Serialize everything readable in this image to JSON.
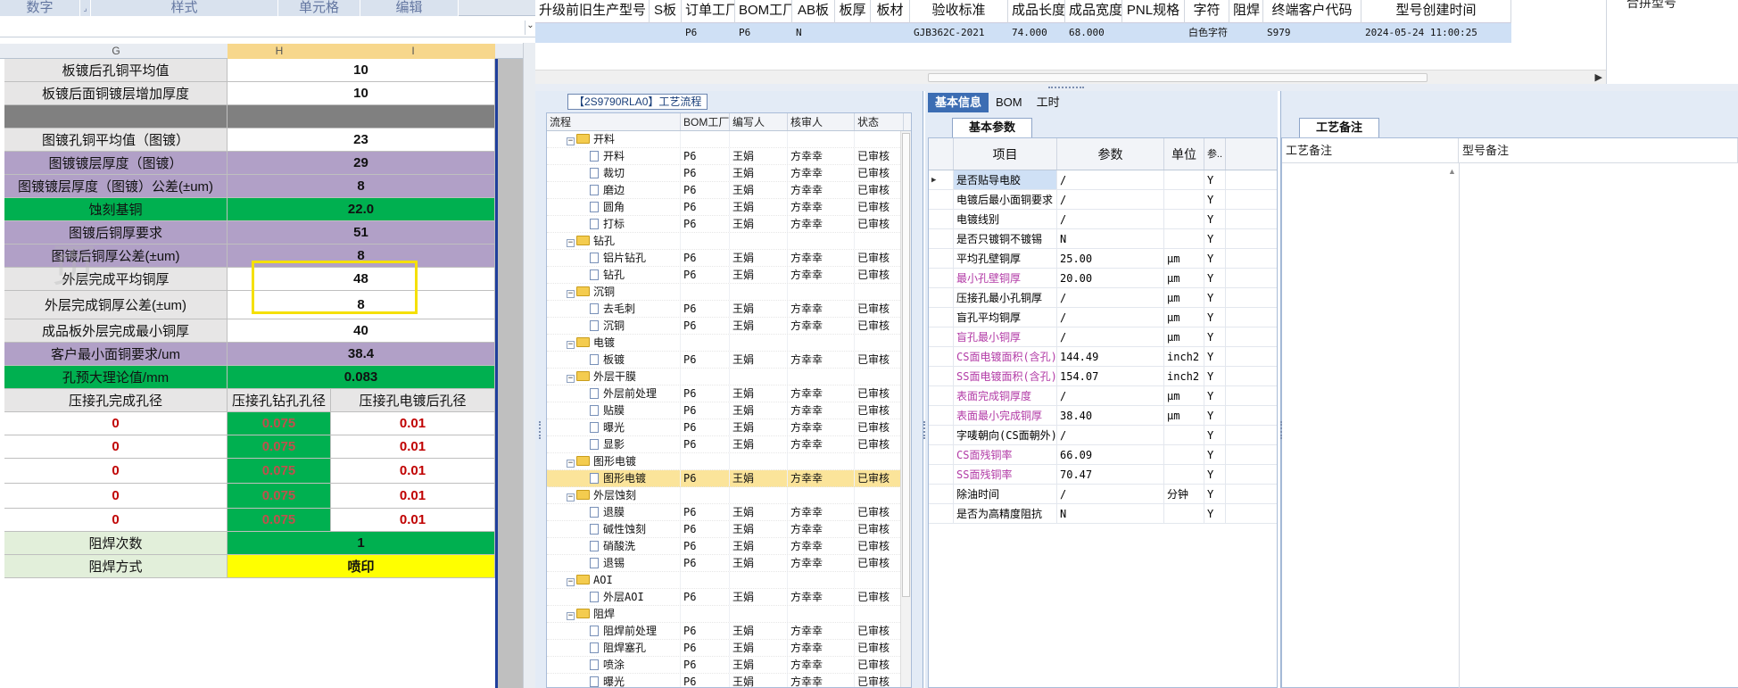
{
  "excel": {
    "ribbon_groups": [
      "数字",
      "样式",
      "单元格",
      "编辑"
    ],
    "columns": [
      "G",
      "H",
      "I"
    ],
    "rows": [
      {
        "label": "板镀后孔铜平均值",
        "value": "10",
        "label_bg": "lgray",
        "value_bg": "white"
      },
      {
        "label": "板镀后面铜镀层增加厚度",
        "value": "10",
        "label_bg": "lgray",
        "value_bg": "white"
      },
      {
        "label": "",
        "value": "",
        "label_bg": "gray",
        "value_bg": "gray"
      },
      {
        "label": "图镀孔铜平均值（图镀）",
        "value": "23",
        "label_bg": "lgray",
        "value_bg": "white"
      },
      {
        "label": "图镀镀层厚度（图镀）",
        "value": "29",
        "label_bg": "lavender",
        "value_bg": "lavender"
      },
      {
        "label": "图镀镀层厚度（图镀）公差(±um)",
        "value": "8",
        "label_bg": "lavender",
        "value_bg": "lavender"
      },
      {
        "label": "蚀刻基铜",
        "value": "22.0",
        "label_bg": "green",
        "value_bg": "green"
      },
      {
        "label": "图镀后铜厚要求",
        "value": "51",
        "label_bg": "lavender",
        "value_bg": "lavender"
      },
      {
        "label": "图镀后铜厚公差(±um)",
        "value": "8",
        "label_bg": "lavender",
        "value_bg": "lavender"
      },
      {
        "label": "外层完成平均铜厚",
        "value": "48",
        "label_bg": "lgray",
        "value_bg": "white"
      },
      {
        "label": "外层完成铜厚公差(±um)",
        "value": "8",
        "label_bg": "lgray",
        "value_bg": "white"
      },
      {
        "label": "成品板外层完成最小铜厚",
        "value": "40",
        "label_bg": "lgray",
        "value_bg": "white"
      },
      {
        "label": "客户最小面铜要求/um",
        "value": "38.4",
        "label_bg": "lavender",
        "value_bg": "lavender"
      },
      {
        "label": "孔预大理论值/mm",
        "value": "0.083",
        "label_bg": "green",
        "value_bg": "green"
      }
    ],
    "hole_header": [
      "压接孔完成孔径",
      "压接孔钻孔孔径",
      "压接孔电镀后孔径"
    ],
    "hole_rows": [
      [
        "0",
        "0.075",
        "0.01"
      ],
      [
        "0",
        "0.075",
        "0.01"
      ],
      [
        "0",
        "0.075",
        "0.01"
      ],
      [
        "0",
        "0.075",
        "0.01"
      ],
      [
        "0",
        "0.075",
        "0.01"
      ]
    ],
    "solder_count": {
      "label": "阻焊次数",
      "value": "1"
    },
    "solder_method": {
      "label": "阻焊方式",
      "value": "喷印"
    },
    "watermark": "页"
  },
  "top_table": {
    "headers": [
      "升级前旧生产型号",
      "S板",
      "订单工厂",
      "BOM工厂",
      "AB板",
      "板厚",
      "板材",
      "验收标准",
      "成品长度",
      "成品宽度",
      "PNL规格",
      "字符",
      "阻焊",
      "终端客户代码",
      "型号创建时间"
    ],
    "row": [
      "",
      "",
      "P6",
      "P6",
      "N",
      "",
      "",
      "GJB362C-2021",
      "74.000",
      "68.000",
      "",
      "白色字符",
      "",
      "S979",
      "2024-05-24 11:00:25"
    ],
    "right_panel_label": "合拼型号"
  },
  "process": {
    "title": "【2S9790RLA0】工艺流程",
    "columns": [
      "流程",
      "BOM工厂",
      "编写人",
      "核审人",
      "状态"
    ],
    "rows": [
      {
        "name": "开料",
        "type": "folder"
      },
      {
        "name": "开料",
        "type": "doc",
        "fac": "P6",
        "writer": "王娟",
        "checker": "方幸幸",
        "status": "已审核"
      },
      {
        "name": "裁切",
        "type": "doc",
        "fac": "P6",
        "writer": "王娟",
        "checker": "方幸幸",
        "status": "已审核"
      },
      {
        "name": "磨边",
        "type": "doc",
        "fac": "P6",
        "writer": "王娟",
        "checker": "方幸幸",
        "status": "已审核"
      },
      {
        "name": "圆角",
        "type": "doc",
        "fac": "P6",
        "writer": "王娟",
        "checker": "方幸幸",
        "status": "已审核"
      },
      {
        "name": "打标",
        "type": "doc",
        "fac": "P6",
        "writer": "王娟",
        "checker": "方幸幸",
        "status": "已审核"
      },
      {
        "name": "钻孔",
        "type": "folder"
      },
      {
        "name": "铝片钻孔",
        "type": "doc",
        "fac": "P6",
        "writer": "王娟",
        "checker": "方幸幸",
        "status": "已审核"
      },
      {
        "name": "钻孔",
        "type": "doc",
        "fac": "P6",
        "writer": "王娟",
        "checker": "方幸幸",
        "status": "已审核"
      },
      {
        "name": "沉铜",
        "type": "folder"
      },
      {
        "name": "去毛刺",
        "type": "doc",
        "fac": "P6",
        "writer": "王娟",
        "checker": "方幸幸",
        "status": "已审核"
      },
      {
        "name": "沉铜",
        "type": "doc",
        "fac": "P6",
        "writer": "王娟",
        "checker": "方幸幸",
        "status": "已审核"
      },
      {
        "name": "电镀",
        "type": "folder"
      },
      {
        "name": "板镀",
        "type": "doc",
        "fac": "P6",
        "writer": "王娟",
        "checker": "方幸幸",
        "status": "已审核"
      },
      {
        "name": "外层干膜",
        "type": "folder"
      },
      {
        "name": "外层前处理",
        "type": "doc",
        "fac": "P6",
        "writer": "王娟",
        "checker": "方幸幸",
        "status": "已审核"
      },
      {
        "name": "贴膜",
        "type": "doc",
        "fac": "P6",
        "writer": "王娟",
        "checker": "方幸幸",
        "status": "已审核"
      },
      {
        "name": "曝光",
        "type": "doc",
        "fac": "P6",
        "writer": "王娟",
        "checker": "方幸幸",
        "status": "已审核"
      },
      {
        "name": "显影",
        "type": "doc",
        "fac": "P6",
        "writer": "王娟",
        "checker": "方幸幸",
        "status": "已审核"
      },
      {
        "name": "图形电镀",
        "type": "folder"
      },
      {
        "name": "图形电镀",
        "type": "doc",
        "fac": "P6",
        "writer": "王娟",
        "checker": "方幸幸",
        "status": "已审核",
        "selected": true
      },
      {
        "name": "外层蚀刻",
        "type": "folder"
      },
      {
        "name": "退膜",
        "type": "doc",
        "fac": "P6",
        "writer": "王娟",
        "checker": "方幸幸",
        "status": "已审核"
      },
      {
        "name": "碱性蚀刻",
        "type": "doc",
        "fac": "P6",
        "writer": "王娟",
        "checker": "方幸幸",
        "status": "已审核"
      },
      {
        "name": "硝酸洗",
        "type": "doc",
        "fac": "P6",
        "writer": "王娟",
        "checker": "方幸幸",
        "status": "已审核"
      },
      {
        "name": "退锡",
        "type": "doc",
        "fac": "P6",
        "writer": "王娟",
        "checker": "方幸幸",
        "status": "已审核"
      },
      {
        "name": "AOI",
        "type": "folder"
      },
      {
        "name": "外层AOI",
        "type": "doc",
        "fac": "P6",
        "writer": "王娟",
        "checker": "方幸幸",
        "status": "已审核"
      },
      {
        "name": "阻焊",
        "type": "folder"
      },
      {
        "name": "阻焊前处理",
        "type": "doc",
        "fac": "P6",
        "writer": "王娟",
        "checker": "方幸幸",
        "status": "已审核"
      },
      {
        "name": "阻焊塞孔",
        "type": "doc",
        "fac": "P6",
        "writer": "王娟",
        "checker": "方幸幸",
        "status": "已审核"
      },
      {
        "name": "喷涂",
        "type": "doc",
        "fac": "P6",
        "writer": "王娟",
        "checker": "方幸幸",
        "status": "已审核"
      },
      {
        "name": "曝光",
        "type": "doc",
        "fac": "P6",
        "writer": "王娟",
        "checker": "方幸幸",
        "status": "已审核"
      }
    ]
  },
  "info": {
    "tabs": [
      "基本信息",
      "BOM",
      "工时"
    ],
    "sub_tab": "基本参数",
    "columns": [
      "项目",
      "参数",
      "单位",
      "参.."
    ],
    "rows": [
      {
        "item": "是否贴导电胶",
        "value": "/",
        "unit": "",
        "flag": "Y",
        "pink": false
      },
      {
        "item": "电镀后最小面铜要求",
        "value": "/",
        "unit": "",
        "flag": "Y",
        "pink": false
      },
      {
        "item": "电镀线别",
        "value": "/",
        "unit": "",
        "flag": "Y",
        "pink": false
      },
      {
        "item": "是否只镀铜不镀锡",
        "value": "N",
        "unit": "",
        "flag": "Y",
        "pink": false
      },
      {
        "item": "平均孔壁铜厚",
        "value": "25.00",
        "unit": "μm",
        "flag": "Y",
        "pink": false
      },
      {
        "item": "最小孔壁铜厚",
        "value": "20.00",
        "unit": "μm",
        "flag": "Y",
        "pink": true
      },
      {
        "item": "压接孔最小孔铜厚",
        "value": "/",
        "unit": "μm",
        "flag": "Y",
        "pink": false
      },
      {
        "item": "盲孔平均铜厚",
        "value": "/",
        "unit": "μm",
        "flag": "Y",
        "pink": false
      },
      {
        "item": "盲孔最小铜厚",
        "value": "/",
        "unit": "μm",
        "flag": "Y",
        "pink": true
      },
      {
        "item": "CS面电镀面积(含孔)",
        "value": "144.49",
        "unit": "inch2",
        "flag": "Y",
        "pink": true
      },
      {
        "item": "SS面电镀面积(含孔)",
        "value": "154.07",
        "unit": "inch2",
        "flag": "Y",
        "pink": true
      },
      {
        "item": "表面完成铜厚度",
        "value": "/",
        "unit": "μm",
        "flag": "Y",
        "pink": true
      },
      {
        "item": "表面最小完成铜厚",
        "value": "38.40",
        "unit": "μm",
        "flag": "Y",
        "pink": true
      },
      {
        "item": "字唛朝向(CS面朝外)",
        "value": "/",
        "unit": "",
        "flag": "Y",
        "pink": false
      },
      {
        "item": "CS面残铜率",
        "value": "66.09",
        "unit": "",
        "flag": "Y",
        "pink": true
      },
      {
        "item": "SS面残铜率",
        "value": "70.47",
        "unit": "",
        "flag": "Y",
        "pink": true
      },
      {
        "item": "除油时间",
        "value": "/",
        "unit": "分钟",
        "flag": "Y",
        "pink": false
      },
      {
        "item": "是否为高精度阻抗",
        "value": "N",
        "unit": "",
        "flag": "Y",
        "pink": false
      }
    ]
  },
  "remarks": {
    "tab": "工艺备注",
    "columns": [
      "工艺备注",
      "型号备注"
    ]
  },
  "colors": {
    "lavender": "#b1a0c7",
    "green": "#00b050",
    "yellow_highlight": "#f5e000",
    "selection": "#cfe0f5",
    "tab_active": "#3c6db3"
  }
}
